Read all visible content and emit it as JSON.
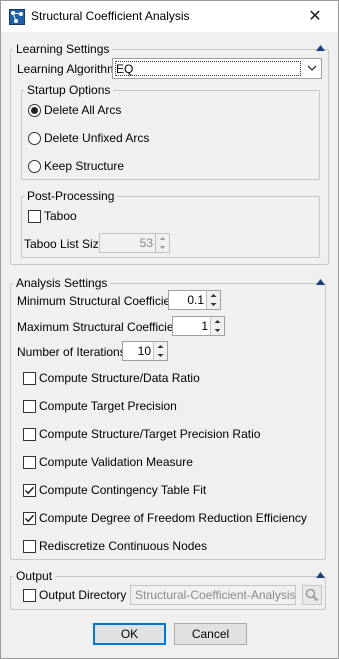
{
  "window": {
    "title": "Structural Coefficient Analysis",
    "app_icon": "network-graph-icon",
    "close_icon": "close-icon",
    "close_glyph": "✕"
  },
  "learning_settings": {
    "legend": "Learning Settings",
    "algorithm_label": "Learning Algorithm",
    "algorithm_value": "EQ",
    "startup_options": {
      "legend": "Startup Options",
      "options": [
        "Delete All Arcs",
        "Delete Unfixed Arcs",
        "Keep Structure"
      ],
      "selected": "Delete All Arcs"
    },
    "post_processing": {
      "legend": "Post-Processing",
      "taboo_label": "Taboo",
      "taboo_checked": false,
      "taboo_list_size_label": "Taboo List Size",
      "taboo_list_size_value": "53"
    }
  },
  "analysis_settings": {
    "legend": "Analysis Settings",
    "min_coef_label": "Minimum Structural Coefficient",
    "min_coef_value": "0.1",
    "max_coef_label": "Maximum Structural Coefficient",
    "max_coef_value": "1",
    "iterations_label": "Number of Iterations",
    "iterations_value": "10",
    "checkboxes": [
      {
        "label": "Compute Structure/Data Ratio",
        "checked": false
      },
      {
        "label": "Compute Target Precision",
        "checked": false
      },
      {
        "label": "Compute Structure/Target Precision Ratio",
        "checked": false
      },
      {
        "label": "Compute Validation Measure",
        "checked": false
      },
      {
        "label": "Compute Contingency Table Fit",
        "checked": true
      },
      {
        "label": "Compute Degree of Freedom Reduction Efficiency",
        "checked": true
      },
      {
        "label": "Rediscretize Continuous Nodes",
        "checked": false
      }
    ]
  },
  "output": {
    "legend": "Output",
    "directory_label": "Output Directory",
    "directory_checked": false,
    "directory_value": "Structural-Coefficient-Analysis",
    "browse_icon": "browse-folder-icon"
  },
  "buttons": {
    "ok": "OK",
    "cancel": "Cancel"
  },
  "colors": {
    "accent": "#0078d7",
    "icon_blue": "#1e5fa8",
    "collapse_arrow": "#1f3f7a"
  }
}
